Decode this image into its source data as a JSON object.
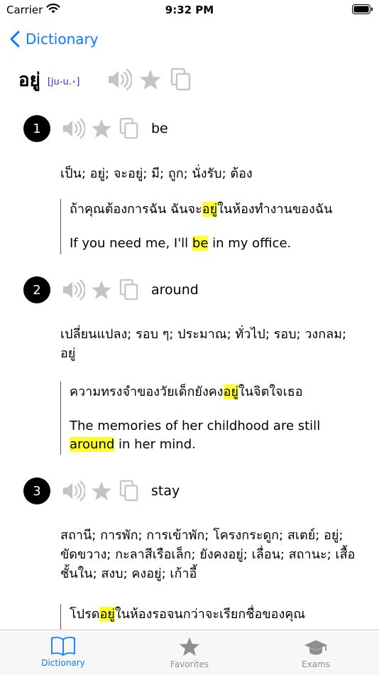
{
  "status_bar": {
    "carrier": "Carrier",
    "time": "9:32 PM"
  },
  "nav": {
    "back_label": "Dictionary"
  },
  "header": {
    "headword": "อยู่",
    "phonetic": "[ju-u.˔]"
  },
  "senses": [
    {
      "number": "1",
      "word": "be",
      "translation": "เป็น; อยู่; จะอยู่; มี; ถูก; นั่งรับ; ต้อง",
      "example_th": {
        "before": "ถ้าคุณต้องการฉัน ฉันจะ",
        "highlight": "อยู่",
        "after": "ในห้องทำงานของฉัน"
      },
      "example_en": {
        "before": "If you need me, I'll ",
        "highlight": "be",
        "after": " in my office."
      }
    },
    {
      "number": "2",
      "word": "around",
      "translation": "เปลี่ยนแปลง; รอบ ๆ; ประมาณ; ทั่วไป; รอบ; วงกลม; อยู่",
      "example_th": {
        "before": "ความทรงจำของวัยเด็กยังคง",
        "highlight": "อยู่",
        "after": "ในจิตใจเธอ"
      },
      "example_en": {
        "before": "The memories of her childhood are still ",
        "highlight": "around",
        "after": " in her mind."
      }
    },
    {
      "number": "3",
      "word": "stay",
      "translation": "สถานี; การพัก; การเข้าพัก; โครงกระดูก; สเตย์; อยู่; ขัดขวาง; กะลาสีเรือเล็ก; ยังคงอยู่; เลื่อน; สถานะ; เสื้อชั้นใน; สงบ; คงอยู่; เก้าอี้",
      "example_th": {
        "before": "โปรด",
        "highlight": "อยู่",
        "after": "ในห้องรอจนกว่าจะเรียกชื่อของคุณ"
      }
    }
  ],
  "tabs": [
    {
      "label": "Dictionary",
      "icon": "book-icon",
      "active": true
    },
    {
      "label": "Favorites",
      "icon": "star-icon",
      "active": false
    },
    {
      "label": "Exams",
      "icon": "graduation-cap-icon",
      "active": false
    }
  ],
  "colors": {
    "accent": "#0a7aff",
    "highlight": "#ffff2a",
    "icon_gray": "#c4c4c4",
    "phonetic": "#3333cc"
  }
}
